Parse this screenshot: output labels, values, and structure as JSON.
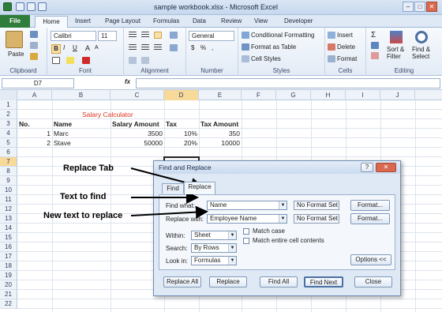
{
  "window": {
    "title": "sample workbook.xlsx - Microsoft Excel",
    "minimize": "–",
    "maximize": "□",
    "close": "✕"
  },
  "tabs": {
    "file": "File",
    "items": [
      "Home",
      "Insert",
      "Page Layout",
      "Formulas",
      "Data",
      "Review",
      "View",
      "Developer"
    ]
  },
  "ribbon": {
    "clipboard": {
      "paste": "Paste",
      "label": "Clipboard"
    },
    "font": {
      "name": "Calibri",
      "size": "11",
      "bold": "B",
      "italic": "I",
      "underline": "U",
      "grow": "A",
      "shrink": "A",
      "label": "Font"
    },
    "alignment": {
      "label": "Alignment"
    },
    "number": {
      "format": "General",
      "currency": "$",
      "percent": "%",
      "comma": ",",
      "label": "Number"
    },
    "styles": {
      "conditional": "Conditional Formatting",
      "table": "Format as Table",
      "cell": "Cell Styles",
      "label": "Styles"
    },
    "cells": {
      "insert": "Insert",
      "delete": "Delete",
      "format": "Format",
      "label": "Cells"
    },
    "editing": {
      "sigma": "Σ",
      "sort_line1": "Sort &",
      "sort_line2": "Filter",
      "find_line1": "Find &",
      "find_line2": "Select",
      "label": "Editing"
    }
  },
  "formula_bar": {
    "name_box": "D7",
    "fx": "fx",
    "value": ""
  },
  "columns": [
    "A",
    "B",
    "C",
    "D",
    "E",
    "F",
    "G",
    "H",
    "I",
    "J"
  ],
  "rows": [
    "1",
    "2",
    "3",
    "4",
    "5",
    "6",
    "7",
    "8",
    "9",
    "10",
    "11",
    "12",
    "13",
    "14",
    "15",
    "16",
    "17",
    "18",
    "19",
    "20",
    "21",
    "22"
  ],
  "sheet": {
    "heading": "Salary Calculator",
    "headers": {
      "no": "No.",
      "name": "Name",
      "salary": "Salary Amount",
      "tax": "Tax",
      "tax_amount": "Tax Amount"
    },
    "rows": [
      {
        "no": "1",
        "name": "Marc",
        "salary": "3500",
        "tax": "10%",
        "tax_amount": "350"
      },
      {
        "no": "2",
        "name": "Stave",
        "salary": "50000",
        "tax": "20%",
        "tax_amount": "10000"
      }
    ]
  },
  "annotations": {
    "replace_tab": "Replace Tab",
    "text_to_find": "Text to find",
    "new_text": "New text to replace"
  },
  "dialog": {
    "title": "Find and Replace",
    "help": "?",
    "close": "✕",
    "tab_find": "Find",
    "tab_replace": "Replace",
    "find_what_label": "Find what:",
    "find_what_value": "Name",
    "replace_with_label": "Replace with:",
    "replace_with_value": "Employee Name",
    "no_format_1": "No Format Set",
    "no_format_2": "No Format Set",
    "format_btn_1": "Format...",
    "format_btn_2": "Format...",
    "within_label": "Within:",
    "within_value": "Sheet",
    "search_label": "Search:",
    "search_value": "By Rows",
    "lookin_label": "Look in:",
    "lookin_value": "Formulas",
    "match_case": "Match case",
    "match_entire": "Match entire cell contents",
    "options_btn": "Options <<",
    "replace_all": "Replace All",
    "replace": "Replace",
    "find_all": "Find All",
    "find_next": "Find Next",
    "close_btn": "Close"
  }
}
